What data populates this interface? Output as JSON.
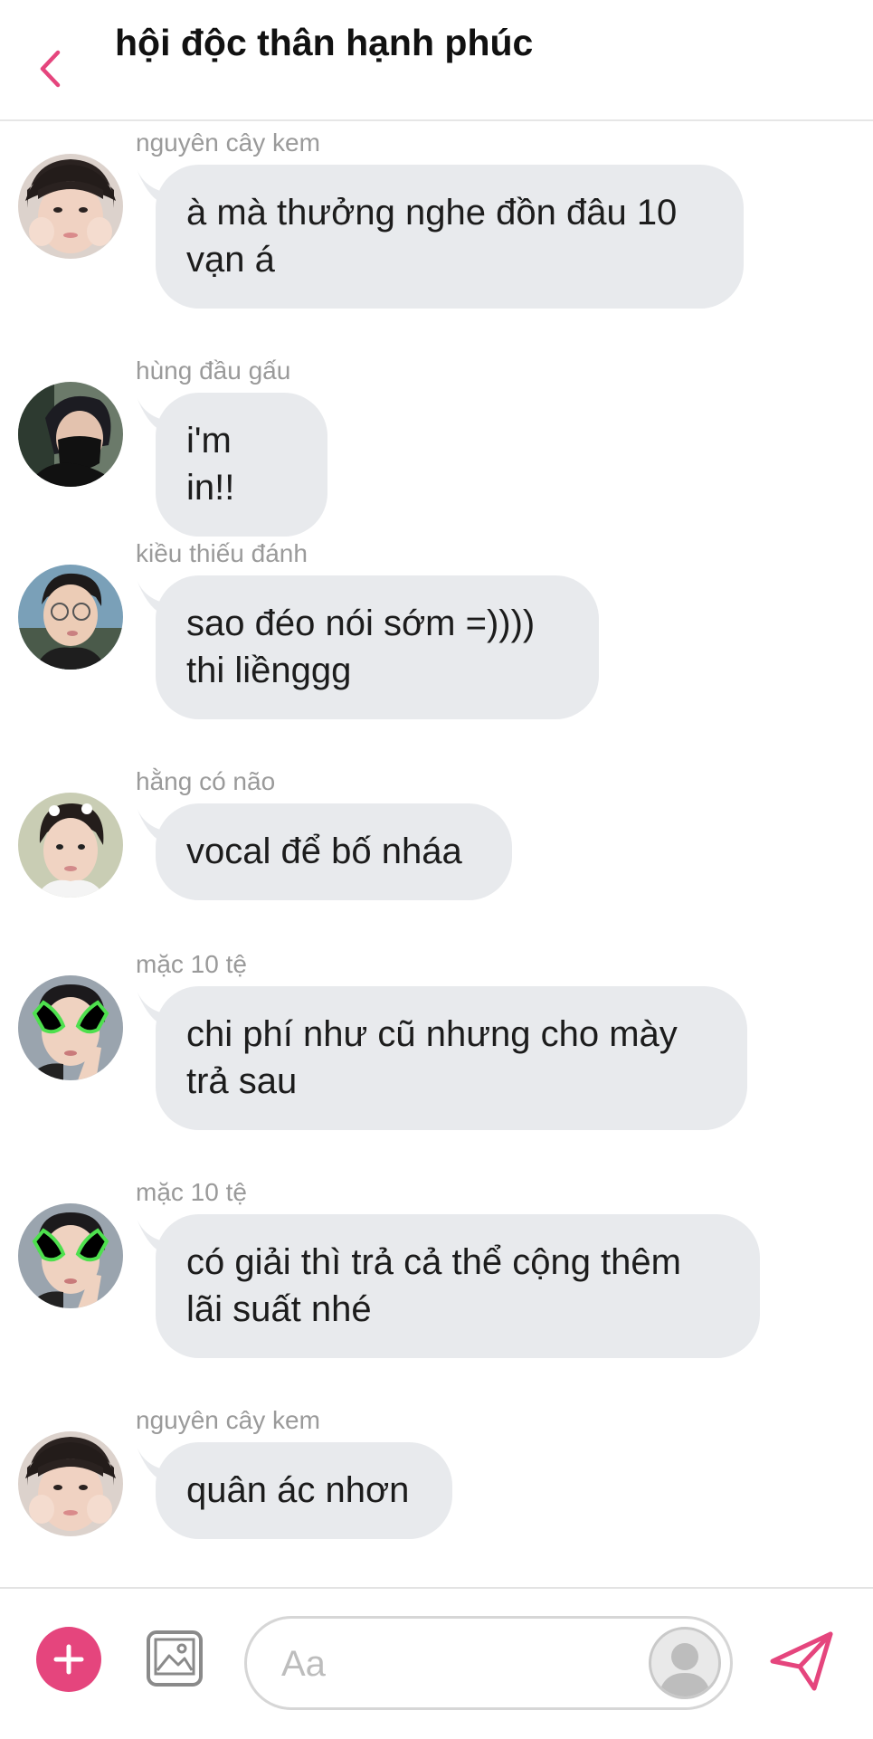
{
  "header": {
    "title": "hội độc thân hạnh phúc"
  },
  "theme": {
    "accent": "#e5457d",
    "bubble": "#e8eaed"
  },
  "messages": [
    {
      "sender": "nguyên cây kem",
      "text": "à mà thưởng nghe đồn đâu 10 vạn á",
      "avatar": "avatar-nguyen-cay-kem"
    },
    {
      "sender": "hùng đầu gấu",
      "text": "i'm in!!",
      "avatar": "avatar-hung-dau-gau"
    },
    {
      "sender": "kiều thiếu đánh",
      "text": "sao đéo nói sớm =)))) thi liềnggg",
      "avatar": "avatar-kieu-thieu-danh"
    },
    {
      "sender": "hằng có não",
      "text": "vocal để bố nháa",
      "avatar": "avatar-hang-co-nao"
    },
    {
      "sender": "mặc 10 tệ",
      "text": "chi phí như cũ nhưng cho mày trả sau",
      "avatar": "avatar-mac-10-te"
    },
    {
      "sender": "mặc 10 tệ",
      "text": "có giải thì trả cả thể cộng thêm lãi suất nhé",
      "avatar": "avatar-mac-10-te"
    },
    {
      "sender": "nguyên cây kem",
      "text": "quân ác nhơn",
      "avatar": "avatar-nguyen-cay-kem"
    }
  ],
  "composer": {
    "placeholder": "Aa",
    "icons": [
      "plus-icon",
      "image-icon",
      "sticker-icon",
      "send-icon"
    ]
  }
}
